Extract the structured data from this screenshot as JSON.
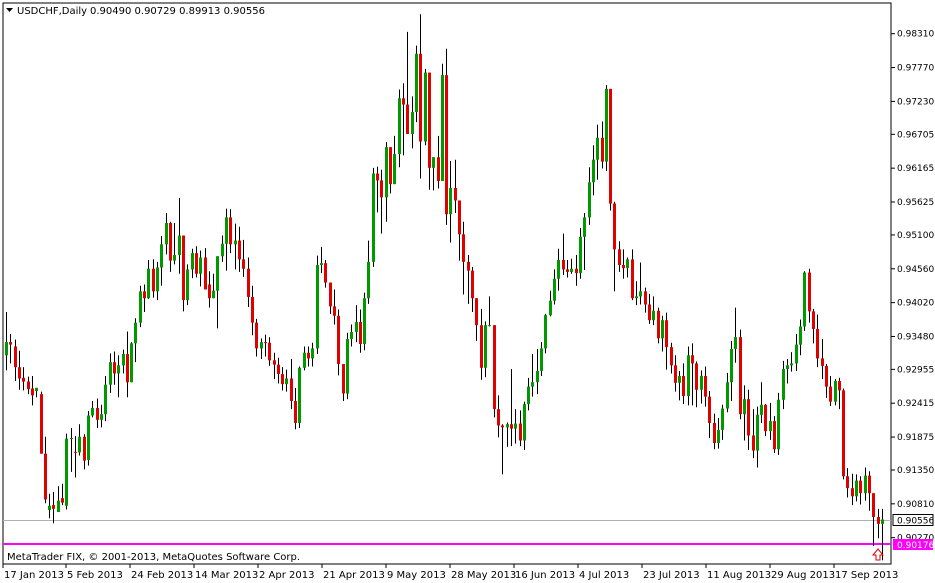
{
  "header": {
    "symbol": "USDCHF,Daily",
    "ohlc": "0.90490 0.90729 0.89913 0.90556"
  },
  "footer": {
    "copyright": "MetaTrader FIX, © 2001-2013, MetaQuotes Software Corp."
  },
  "colors": {
    "background": "#ffffff",
    "bull": "#009900",
    "bear": "#e00000",
    "wick": "#000000",
    "support_line": "#ff00ff",
    "bid_line": "#b0b0b0"
  },
  "chart_data": {
    "type": "candlestick",
    "title": "USDCHF,Daily",
    "x_tick_labels": [
      "17 Jan 2013",
      "5 Feb 2013",
      "24 Feb 2013",
      "14 Mar 2013",
      "2 Apr 2013",
      "21 Apr 2013",
      "9 May 2013",
      "28 May 2013",
      "16 Jun 2013",
      "4 Jul 2013",
      "23 Jul 2013",
      "11 Aug 2013",
      "29 Aug 2013",
      "17 Sep 2013"
    ],
    "y_tick_labels": [
      "0.98310",
      "0.97770",
      "0.97230",
      "0.96705",
      "0.96165",
      "0.95625",
      "0.95100",
      "0.94560",
      "0.94020",
      "0.93480",
      "0.92955",
      "0.92415",
      "0.91875",
      "0.91350",
      "0.90810",
      "0.90270"
    ],
    "ylim": [
      0.8985,
      0.988
    ],
    "current_price": {
      "value": 0.90556,
      "label": "0.90556"
    },
    "support_level": {
      "value": 0.90176,
      "label": "0.90176"
    },
    "arrow_marker": {
      "shape": "up-arrow"
    },
    "candles": [
      [
        0.9318,
        0.9387,
        0.9294,
        0.9339
      ],
      [
        0.9339,
        0.9352,
        0.9305,
        0.9335
      ],
      [
        0.9332,
        0.9343,
        0.9277,
        0.9299
      ],
      [
        0.9299,
        0.9325,
        0.9263,
        0.9281
      ],
      [
        0.9282,
        0.9299,
        0.9262,
        0.9276
      ],
      [
        0.9276,
        0.9284,
        0.9256,
        0.9264
      ],
      [
        0.9265,
        0.9285,
        0.9238,
        0.9254
      ],
      [
        0.9261,
        0.9266,
        0.9251,
        0.9266
      ],
      [
        0.9256,
        0.926,
        0.9163,
        0.9161
      ],
      [
        0.9161,
        0.9188,
        0.9082,
        0.9088
      ],
      [
        0.9071,
        0.9097,
        0.9058,
        0.9078
      ],
      [
        0.9079,
        0.91,
        0.905,
        0.9073
      ],
      [
        0.9068,
        0.9109,
        0.9072,
        0.9086
      ],
      [
        0.909,
        0.9113,
        0.9079,
        0.9083
      ],
      [
        0.9078,
        0.9193,
        0.9072,
        0.9185
      ],
      [
        0.9185,
        0.9202,
        0.9132,
        0.9186
      ],
      [
        0.9164,
        0.9189,
        0.9123,
        0.9163
      ],
      [
        0.9163,
        0.9208,
        0.9158,
        0.9188
      ],
      [
        0.9188,
        0.9192,
        0.9136,
        0.915
      ],
      [
        0.9151,
        0.9229,
        0.9142,
        0.9222
      ],
      [
        0.9222,
        0.9245,
        0.9219,
        0.9234
      ],
      [
        0.9234,
        0.9249,
        0.9202,
        0.9215
      ],
      [
        0.9215,
        0.9239,
        0.9203,
        0.9224
      ],
      [
        0.9224,
        0.9285,
        0.9213,
        0.9271
      ],
      [
        0.9271,
        0.9321,
        0.9258,
        0.9307
      ],
      [
        0.9307,
        0.9324,
        0.9271,
        0.9289
      ],
      [
        0.9289,
        0.9318,
        0.9251,
        0.9302
      ],
      [
        0.9302,
        0.9327,
        0.9289,
        0.932
      ],
      [
        0.932,
        0.9356,
        0.9251,
        0.9275
      ],
      [
        0.9275,
        0.9339,
        0.9285,
        0.9337
      ],
      [
        0.9337,
        0.9377,
        0.9307,
        0.937
      ],
      [
        0.937,
        0.9429,
        0.9363,
        0.942
      ],
      [
        0.942,
        0.9431,
        0.9387,
        0.9409
      ],
      [
        0.9409,
        0.947,
        0.9408,
        0.9456
      ],
      [
        0.9456,
        0.9471,
        0.941,
        0.942
      ],
      [
        0.942,
        0.9467,
        0.9406,
        0.9458
      ],
      [
        0.9458,
        0.9508,
        0.9429,
        0.9495
      ],
      [
        0.9495,
        0.9545,
        0.9479,
        0.9529
      ],
      [
        0.9529,
        0.9531,
        0.9451,
        0.9469
      ],
      [
        0.9469,
        0.9529,
        0.9463,
        0.9478
      ],
      [
        0.9478,
        0.9569,
        0.9448,
        0.9509
      ],
      [
        0.9509,
        0.9499,
        0.9388,
        0.9406
      ],
      [
        0.9406,
        0.9463,
        0.9398,
        0.9455
      ],
      [
        0.9455,
        0.9488,
        0.9441,
        0.9481
      ],
      [
        0.9481,
        0.9492,
        0.9442,
        0.9448
      ],
      [
        0.9448,
        0.9485,
        0.9428,
        0.9474
      ],
      [
        0.9474,
        0.9489,
        0.9441,
        0.9423
      ],
      [
        0.9431,
        0.9452,
        0.9394,
        0.9409
      ],
      [
        0.9409,
        0.9448,
        0.941,
        0.9421
      ],
      [
        0.9421,
        0.9476,
        0.9361,
        0.9476
      ],
      [
        0.9476,
        0.9509,
        0.9467,
        0.9496
      ],
      [
        0.9496,
        0.9552,
        0.9453,
        0.9538
      ],
      [
        0.9538,
        0.9551,
        0.9481,
        0.9495
      ],
      [
        0.9495,
        0.9528,
        0.9455,
        0.9501
      ],
      [
        0.9501,
        0.9523,
        0.9451,
        0.9471
      ],
      [
        0.9471,
        0.9502,
        0.9443,
        0.9456
      ],
      [
        0.9456,
        0.9474,
        0.9395,
        0.9411
      ],
      [
        0.9411,
        0.9429,
        0.935,
        0.937
      ],
      [
        0.937,
        0.9376,
        0.9316,
        0.9329
      ],
      [
        0.9329,
        0.9345,
        0.9312,
        0.9339
      ],
      [
        0.9339,
        0.9351,
        0.9316,
        0.9338
      ],
      [
        0.9338,
        0.9347,
        0.9301,
        0.931
      ],
      [
        0.931,
        0.9322,
        0.928,
        0.9303
      ],
      [
        0.9303,
        0.9314,
        0.9273,
        0.9288
      ],
      [
        0.9288,
        0.9299,
        0.9262,
        0.9272
      ],
      [
        0.9272,
        0.9295,
        0.926,
        0.9281
      ],
      [
        0.9281,
        0.9312,
        0.9232,
        0.9245
      ],
      [
        0.9245,
        0.9266,
        0.92,
        0.921
      ],
      [
        0.921,
        0.93,
        0.9202,
        0.9298
      ],
      [
        0.9298,
        0.9332,
        0.9294,
        0.9322
      ],
      [
        0.9322,
        0.9332,
        0.93,
        0.9313
      ],
      [
        0.9313,
        0.9338,
        0.93,
        0.9329
      ],
      [
        0.9329,
        0.9477,
        0.932,
        0.9462
      ],
      [
        0.9462,
        0.9491,
        0.9449,
        0.9465
      ],
      [
        0.9465,
        0.947,
        0.9426,
        0.9434
      ],
      [
        0.9434,
        0.9426,
        0.9384,
        0.9396
      ],
      [
        0.9396,
        0.9423,
        0.9367,
        0.9381
      ],
      [
        0.9381,
        0.9391,
        0.9286,
        0.9304
      ],
      [
        0.9304,
        0.93,
        0.9245,
        0.9257
      ],
      [
        0.9257,
        0.9354,
        0.9248,
        0.9344
      ],
      [
        0.9344,
        0.9367,
        0.9332,
        0.9355
      ],
      [
        0.9355,
        0.9398,
        0.9339,
        0.9371
      ],
      [
        0.9371,
        0.9391,
        0.9322,
        0.9336
      ],
      [
        0.9336,
        0.9418,
        0.9326,
        0.9409
      ],
      [
        0.9409,
        0.9501,
        0.94,
        0.9467
      ],
      [
        0.9467,
        0.9617,
        0.9459,
        0.9608
      ],
      [
        0.9608,
        0.9619,
        0.9546,
        0.9597
      ],
      [
        0.9597,
        0.9614,
        0.9512,
        0.957
      ],
      [
        0.957,
        0.9658,
        0.9531,
        0.965
      ],
      [
        0.965,
        0.965,
        0.9576,
        0.9591
      ],
      [
        0.9591,
        0.9668,
        0.9623,
        0.9639
      ],
      [
        0.9639,
        0.9742,
        0.9618,
        0.9728
      ],
      [
        0.9728,
        0.9752,
        0.9637,
        0.9718
      ],
      [
        0.9718,
        0.9834,
        0.9683,
        0.9671
      ],
      [
        0.9671,
        0.9731,
        0.9648,
        0.9706
      ],
      [
        0.9706,
        0.9812,
        0.969,
        0.9799
      ],
      [
        0.9799,
        0.9862,
        0.96,
        0.9659
      ],
      [
        0.9659,
        0.9775,
        0.9653,
        0.9769
      ],
      [
        0.9769,
        0.972,
        0.9582,
        0.9617
      ],
      [
        0.9617,
        0.9611,
        0.9581,
        0.9634
      ],
      [
        0.9634,
        0.9668,
        0.9584,
        0.9596
      ],
      [
        0.9596,
        0.9783,
        0.9596,
        0.9765
      ],
      [
        0.9765,
        0.9807,
        0.9526,
        0.9543
      ],
      [
        0.9543,
        0.9628,
        0.9498,
        0.9585
      ],
      [
        0.9585,
        0.963,
        0.9545,
        0.9565
      ],
      [
        0.9565,
        0.9545,
        0.9469,
        0.9511
      ],
      [
        0.9511,
        0.9531,
        0.9415,
        0.9467
      ],
      [
        0.9467,
        0.9478,
        0.94,
        0.9453
      ],
      [
        0.9453,
        0.9459,
        0.9387,
        0.9409
      ],
      [
        0.9409,
        0.9394,
        0.9341,
        0.9366
      ],
      [
        0.9366,
        0.9392,
        0.9279,
        0.9298
      ],
      [
        0.9298,
        0.9372,
        0.9283,
        0.9366
      ],
      [
        0.9366,
        0.9412,
        0.9364,
        0.9366
      ],
      [
        0.9366,
        0.9358,
        0.9219,
        0.9232
      ],
      [
        0.9232,
        0.9254,
        0.9187,
        0.9206
      ],
      [
        0.9206,
        0.9208,
        0.9128,
        0.9203
      ],
      [
        0.9203,
        0.9211,
        0.9172,
        0.9208
      ],
      [
        0.9208,
        0.9296,
        0.9173,
        0.9201
      ],
      [
        0.9201,
        0.9232,
        0.9177,
        0.9209
      ],
      [
        0.9209,
        0.923,
        0.9173,
        0.9182
      ],
      [
        0.9182,
        0.9244,
        0.9167,
        0.924
      ],
      [
        0.924,
        0.9282,
        0.923,
        0.9268
      ],
      [
        0.9268,
        0.932,
        0.9252,
        0.9275
      ],
      [
        0.9275,
        0.9328,
        0.9256,
        0.9293
      ],
      [
        0.9293,
        0.9339,
        0.9285,
        0.9329
      ],
      [
        0.9329,
        0.9384,
        0.9321,
        0.9382
      ],
      [
        0.9382,
        0.9421,
        0.938,
        0.9405
      ],
      [
        0.9405,
        0.9455,
        0.9399,
        0.944
      ],
      [
        0.944,
        0.9488,
        0.9421,
        0.947
      ],
      [
        0.947,
        0.9512,
        0.9446,
        0.9455
      ],
      [
        0.9455,
        0.947,
        0.9442,
        0.9451
      ],
      [
        0.9451,
        0.9472,
        0.9448,
        0.9456
      ],
      [
        0.9456,
        0.9478,
        0.9429,
        0.9449
      ],
      [
        0.9449,
        0.9521,
        0.944,
        0.9507
      ],
      [
        0.9507,
        0.9545,
        0.9454,
        0.9538
      ],
      [
        0.9538,
        0.9618,
        0.9526,
        0.9594
      ],
      [
        0.9594,
        0.9653,
        0.9573,
        0.963
      ],
      [
        0.963,
        0.9686,
        0.9598,
        0.9665
      ],
      [
        0.9665,
        0.9691,
        0.9616,
        0.9627
      ],
      [
        0.9627,
        0.9749,
        0.9612,
        0.9743
      ],
      [
        0.9743,
        0.9743,
        0.9549,
        0.956
      ],
      [
        0.956,
        0.9563,
        0.942,
        0.9487
      ],
      [
        0.9487,
        0.95,
        0.9451,
        0.9462
      ],
      [
        0.9462,
        0.9487,
        0.944,
        0.9457
      ],
      [
        0.9457,
        0.9474,
        0.9442,
        0.9471
      ],
      [
        0.9471,
        0.9487,
        0.9406,
        0.9409
      ],
      [
        0.9409,
        0.9436,
        0.9398,
        0.9412
      ],
      [
        0.9412,
        0.9466,
        0.9399,
        0.942
      ],
      [
        0.942,
        0.9426,
        0.9386,
        0.9399
      ],
      [
        0.9399,
        0.9416,
        0.9368,
        0.9374
      ],
      [
        0.9374,
        0.9412,
        0.9366,
        0.9389
      ],
      [
        0.9389,
        0.9394,
        0.9337,
        0.9345
      ],
      [
        0.9345,
        0.9381,
        0.9324,
        0.9374
      ],
      [
        0.9374,
        0.9386,
        0.9295,
        0.9331
      ],
      [
        0.9331,
        0.9338,
        0.9289,
        0.9302
      ],
      [
        0.9302,
        0.9318,
        0.926,
        0.9274
      ],
      [
        0.9274,
        0.9293,
        0.9246,
        0.9285
      ],
      [
        0.9285,
        0.9305,
        0.924,
        0.9253
      ],
      [
        0.9253,
        0.9332,
        0.9238,
        0.9318
      ],
      [
        0.9318,
        0.9337,
        0.9238,
        0.9305
      ],
      [
        0.9305,
        0.9308,
        0.9235,
        0.9263
      ],
      [
        0.9263,
        0.9294,
        0.9241,
        0.9285
      ],
      [
        0.9285,
        0.93,
        0.9236,
        0.9252
      ],
      [
        0.9252,
        0.9261,
        0.9186,
        0.921
      ],
      [
        0.921,
        0.9225,
        0.9168,
        0.9178
      ],
      [
        0.9178,
        0.9218,
        0.9169,
        0.9199
      ],
      [
        0.9199,
        0.9239,
        0.9183,
        0.9233
      ],
      [
        0.9233,
        0.929,
        0.9227,
        0.9275
      ],
      [
        0.9275,
        0.9341,
        0.9245,
        0.9328
      ],
      [
        0.9328,
        0.9394,
        0.9306,
        0.9347
      ],
      [
        0.9347,
        0.9359,
        0.9216,
        0.9224
      ],
      [
        0.9224,
        0.927,
        0.9182,
        0.9248
      ],
      [
        0.9248,
        0.9263,
        0.9167,
        0.919
      ],
      [
        0.919,
        0.9232,
        0.9154,
        0.9166
      ],
      [
        0.9166,
        0.9236,
        0.9139,
        0.9223
      ],
      [
        0.9223,
        0.9275,
        0.921,
        0.9239
      ],
      [
        0.9239,
        0.924,
        0.9189,
        0.9197
      ],
      [
        0.9197,
        0.9242,
        0.9183,
        0.9213
      ],
      [
        0.9213,
        0.9221,
        0.9162,
        0.9168
      ],
      [
        0.9168,
        0.9258,
        0.9159,
        0.9247
      ],
      [
        0.9247,
        0.9309,
        0.9232,
        0.9296
      ],
      [
        0.9296,
        0.9312,
        0.9273,
        0.9302
      ],
      [
        0.9302,
        0.9323,
        0.9292,
        0.9305
      ],
      [
        0.9305,
        0.9352,
        0.9293,
        0.9335
      ],
      [
        0.9335,
        0.9375,
        0.9318,
        0.9364
      ],
      [
        0.9364,
        0.9452,
        0.9357,
        0.945
      ],
      [
        0.945,
        0.9456,
        0.937,
        0.9388
      ],
      [
        0.9388,
        0.9392,
        0.9337,
        0.936
      ],
      [
        0.936,
        0.9383,
        0.9299,
        0.9313
      ],
      [
        0.9313,
        0.9344,
        0.928,
        0.9301
      ],
      [
        0.9301,
        0.9304,
        0.925,
        0.9268
      ],
      [
        0.9268,
        0.9285,
        0.9237,
        0.9244
      ],
      [
        0.9244,
        0.928,
        0.9238,
        0.9277
      ],
      [
        0.9277,
        0.9282,
        0.9232,
        0.9262
      ],
      [
        0.9262,
        0.9265,
        0.912,
        0.9125
      ],
      [
        0.9125,
        0.9138,
        0.9091,
        0.9106
      ],
      [
        0.9106,
        0.9129,
        0.9079,
        0.9093
      ],
      [
        0.9093,
        0.9128,
        0.9085,
        0.9118
      ],
      [
        0.9118,
        0.9125,
        0.908,
        0.9098
      ],
      [
        0.9098,
        0.9139,
        0.9086,
        0.9126
      ],
      [
        0.9126,
        0.9133,
        0.907,
        0.9098
      ],
      [
        0.9098,
        0.9097,
        0.9014,
        0.906
      ],
      [
        0.906,
        0.9073,
        0.9026,
        0.9049
      ],
      [
        0.9049,
        0.9073,
        0.8991,
        0.9056
      ]
    ]
  }
}
